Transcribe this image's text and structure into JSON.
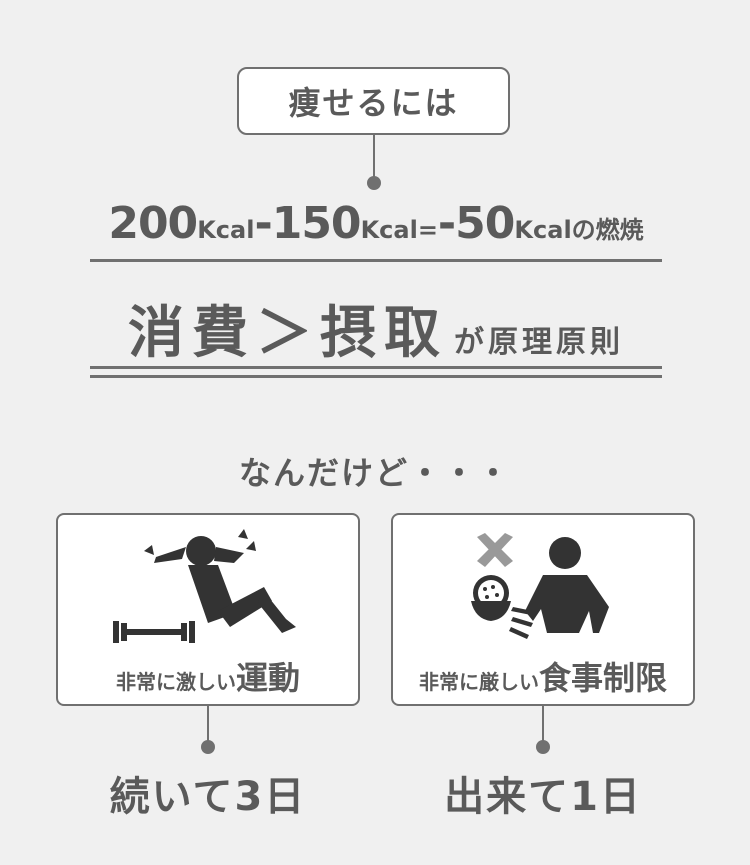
{
  "top_label": "痩せるには",
  "formula": {
    "v1": "200",
    "u1": "Kcal",
    "minus": "-",
    "v2": "150",
    "u2": "Kcal",
    "eq": "=",
    "v3": "-50",
    "u3": "Kcal",
    "tail": "の燃焼"
  },
  "principle": {
    "main": "消費＞摂取",
    "tail": "が原理原則"
  },
  "but": "なんだけど・・・",
  "cards": [
    {
      "label_small": "非常に激しい",
      "label_large": "運動",
      "icon": "exercise-situp-icon",
      "result": "続いて3日"
    },
    {
      "label_small": "非常に厳しい",
      "label_large": "食事制限",
      "icon": "diet-restriction-icon",
      "result": "出来て1日"
    }
  ],
  "colors": {
    "line": "#707070",
    "text": "#5a5a5a",
    "icon": "#333333",
    "background": "#f0f0f0"
  }
}
